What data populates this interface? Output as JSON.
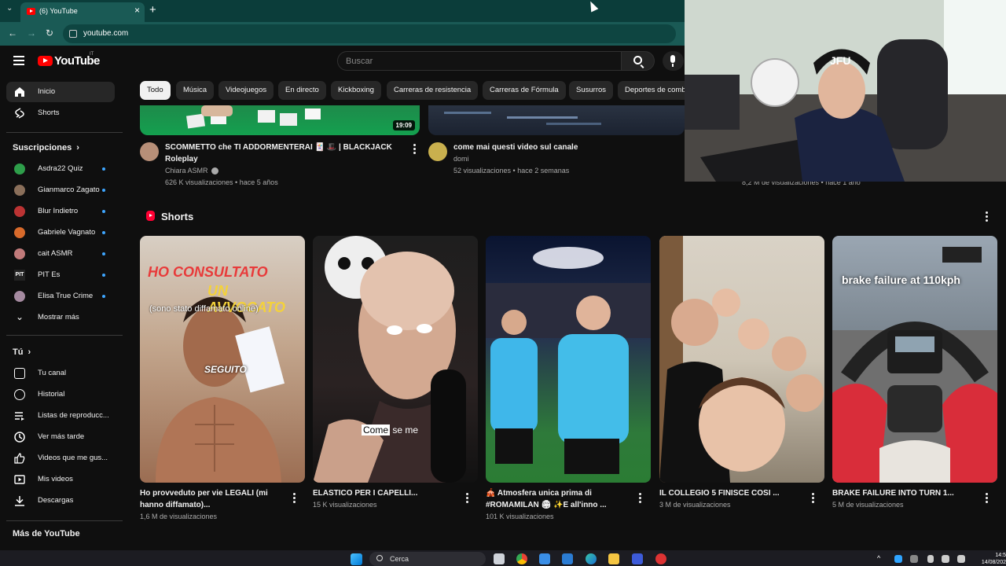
{
  "browser": {
    "tab_title": "(6) YouTube",
    "url": "youtube.com"
  },
  "header": {
    "logo_text": "YouTube",
    "logo_country": "IT",
    "search_placeholder": "Buscar"
  },
  "sidebar": {
    "main": [
      {
        "label": "Inicio",
        "icon": "home-icon"
      },
      {
        "label": "Shorts",
        "icon": "shorts-icon"
      }
    ],
    "subscriptions_title": "Suscripciones",
    "subscriptions": [
      {
        "label": "Asdra22 Quiz",
        "color": "#2e9e4a"
      },
      {
        "label": "Gianmarco Zagato",
        "color": "#8a6f5a"
      },
      {
        "label": "Blur Indietro",
        "color": "#b33"
      },
      {
        "label": "Gabriele Vagnato",
        "color": "#d86a2b"
      },
      {
        "label": "cait ASMR",
        "color": "#c07a7a"
      },
      {
        "label": "PIT Es",
        "color": "#222"
      },
      {
        "label": "Elisa True Crime",
        "color": "#a58aa0"
      }
    ],
    "show_more": "Mostrar más",
    "you_title": "Tú",
    "you_items": [
      {
        "label": "Tu canal",
        "icon": "channel-icon"
      },
      {
        "label": "Historial",
        "icon": "history-icon"
      },
      {
        "label": "Listas de reproducc...",
        "icon": "playlist-icon"
      },
      {
        "label": "Ver más tarde",
        "icon": "clock-icon"
      },
      {
        "label": "Videos que me gus...",
        "icon": "thumbs-up-icon"
      },
      {
        "label": "Mis videos",
        "icon": "video-icon"
      },
      {
        "label": "Descargas",
        "icon": "download-icon"
      }
    ],
    "more_title": "Más de YouTube"
  },
  "chips": [
    "Todo",
    "Música",
    "Videojuegos",
    "En directo",
    "Kickboxing",
    "Carreras de resistencia",
    "Carreras de Fórmula",
    "Susurros",
    "Deportes de comb"
  ],
  "videos": [
    {
      "title": "SCOMMETTO che TI ADDORMENTERAI 🃏 🎩 | BLACKJACK Roleplay",
      "channel": "Chiara ASMR",
      "meta": "626 K visualizaciones • hace 5 años",
      "duration": "19:09"
    },
    {
      "title": "come mai questi video sul canale",
      "channel": "domi",
      "meta": "52 visualizaciones • hace 2 semanas"
    }
  ],
  "hidden_meta": "8,2 M de visualizaciones • hace 1 año",
  "shorts_title": "Shorts",
  "shorts": [
    {
      "title": "Ho provveduto per vie LEGALI (mi hanno diffamato)...",
      "views": "1,6 M de visualizaciones",
      "overlay1": "HO CONSULTATO",
      "overlay2": "UN AVVOCATO",
      "overlay3": "(sono stato diffamato online)",
      "overlay4": "SEGUITO"
    },
    {
      "title": "ELASTICO PER I CAPELLI...",
      "views": "15 K visualizaciones",
      "caption1": "Come",
      "caption2": "se me"
    },
    {
      "title": "🎪 Atmosfera unica prima di #ROMAMILAN 🏟 ✨E all'inno ...",
      "views": "101 K visualizaciones"
    },
    {
      "title": "IL COLLEGIO 5 FINISCE COSI ...",
      "views": "3 M de visualizaciones"
    },
    {
      "title": "BRAKE FAILURE INTO TURN 1...",
      "views": "5 M de visualizaciones",
      "overlay": "brake failure at 110kph"
    }
  ],
  "taskbar": {
    "search": "Cerca",
    "time": "14:5",
    "date": "14/08/202"
  },
  "webcam": {
    "cap_text": "JFU"
  }
}
